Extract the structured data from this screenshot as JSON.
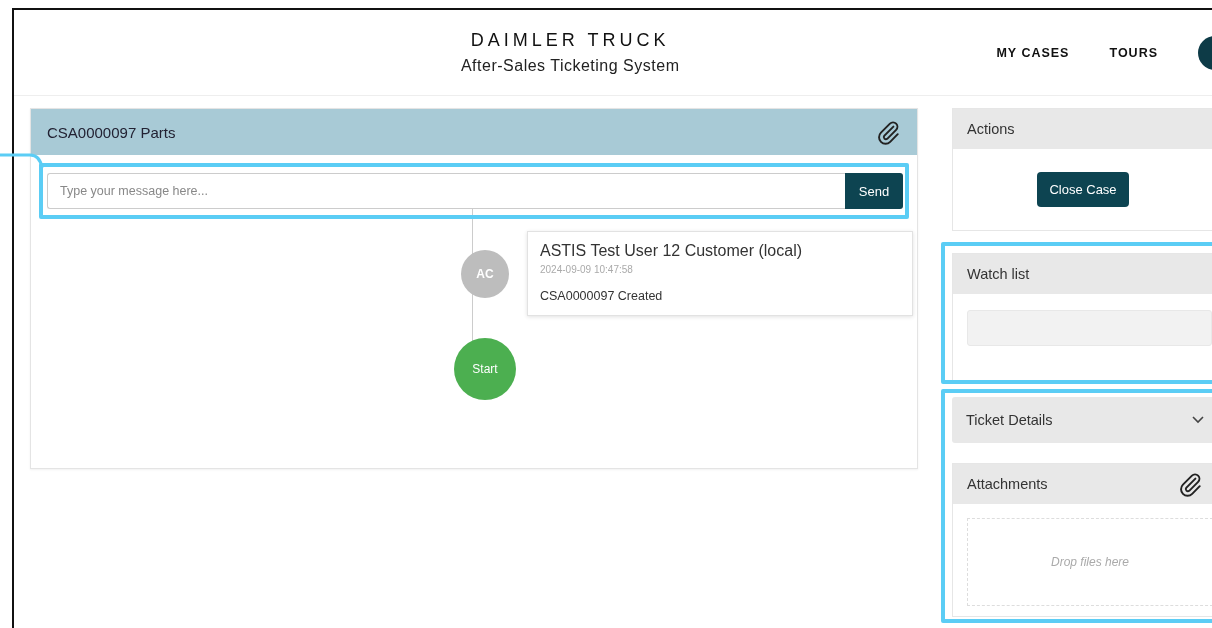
{
  "header": {
    "brand": "DAIMLER TRUCK",
    "subtitle": "After-Sales Ticketing System",
    "nav": [
      {
        "label": "MY CASES"
      },
      {
        "label": "TOURS"
      }
    ]
  },
  "case_panel": {
    "title": "CSA0000097 Parts",
    "message": {
      "placeholder": "Type your message here...",
      "send": "Send"
    },
    "timeline": [
      {
        "kind": "event",
        "avatar": "AC",
        "author": "ASTIS Test User 12 Customer (local)",
        "time": "2024-09-09 10:47:58",
        "text": "CSA0000097 Created"
      },
      {
        "kind": "start",
        "label": "Start"
      }
    ]
  },
  "sidebar": {
    "actions": {
      "title": "Actions",
      "button": "Close Case"
    },
    "watch_list": {
      "title": "Watch list"
    },
    "ticket_details": {
      "title": "Ticket Details",
      "expanded": false
    },
    "attachments": {
      "title": "Attachments",
      "dropzone": "Drop files here"
    }
  }
}
